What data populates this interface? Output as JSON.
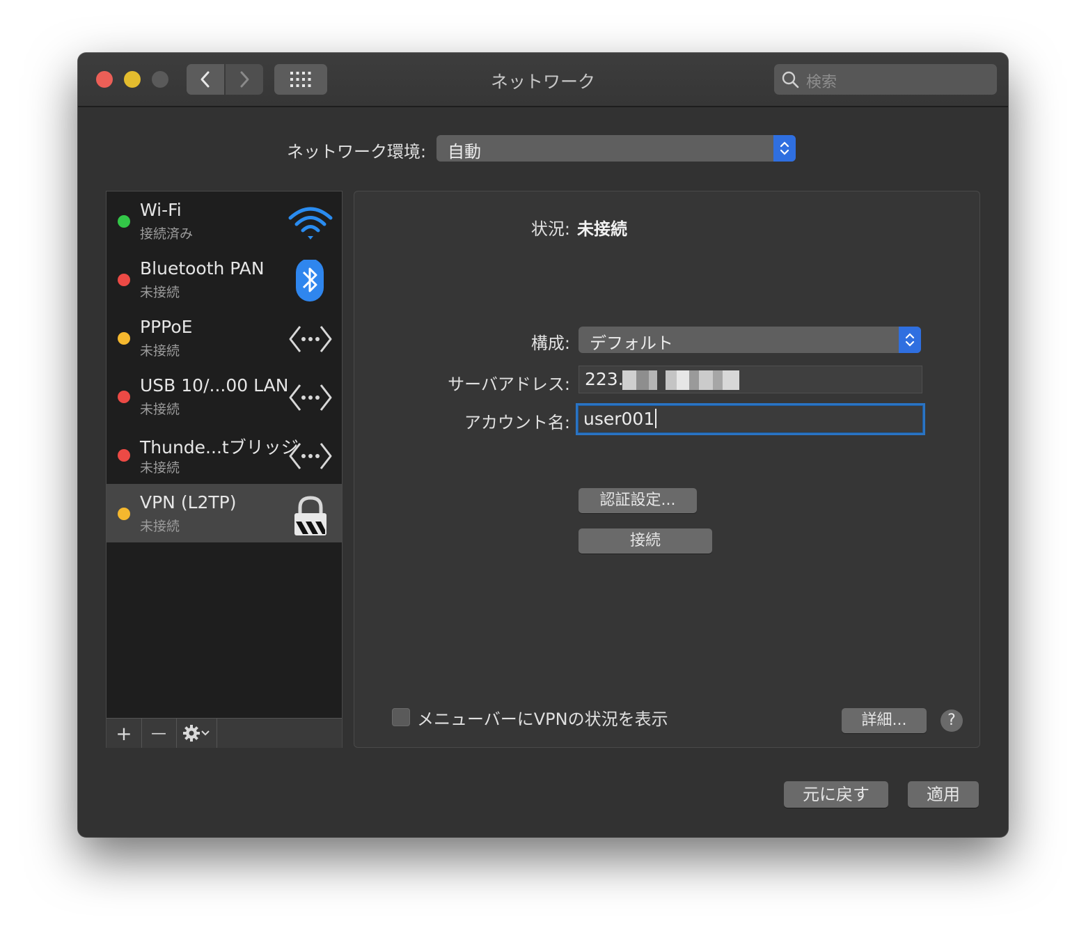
{
  "window": {
    "title": "ネットワーク",
    "search_placeholder": "検索"
  },
  "location": {
    "label": "ネットワーク環境:",
    "value": "自動"
  },
  "services": [
    {
      "name": "Wi-Fi",
      "status": "接続済み",
      "dot_color": "#33c748",
      "icon": "wifi-icon"
    },
    {
      "name": "Bluetooth PAN",
      "status": "未接続",
      "dot_color": "#ec4a45",
      "icon": "bluetooth-icon"
    },
    {
      "name": "PPPoE",
      "status": "未接続",
      "dot_color": "#f5b82e",
      "icon": "ethernet-arrows-icon"
    },
    {
      "name": "USB 10/...00 LAN",
      "status": "未接続",
      "dot_color": "#ec4a45",
      "icon": "ethernet-arrows-icon"
    },
    {
      "name": "Thunde...tブリッジ",
      "status": "未接続",
      "dot_color": "#ec4a45",
      "icon": "ethernet-arrows-icon"
    },
    {
      "name": "VPN (L2TP)",
      "status": "未接続",
      "dot_color": "#f5b82e",
      "icon": "vpn-lock-icon",
      "selected": true
    }
  ],
  "toolbar": {
    "add": "+",
    "remove": "—"
  },
  "detail": {
    "status_label": "状況:",
    "status_value": "未接続",
    "config_label": "構成:",
    "config_value": "デフォルト",
    "server_label": "サーバアドレス:",
    "server_value": "223.",
    "account_label": "アカウント名:",
    "account_value": "user001",
    "auth_button": "認証設定...",
    "connect_button": "接続",
    "menubar_checkbox_label": "メニューバーにVPNの状況を表示",
    "menubar_checked": false,
    "advanced_button": "詳細...",
    "help": "?"
  },
  "footer": {
    "revert_button": "元に戻す",
    "apply_button": "適用"
  },
  "colors": {
    "accent": "#2f6fe0",
    "focus_ring": "#2a74c4"
  }
}
